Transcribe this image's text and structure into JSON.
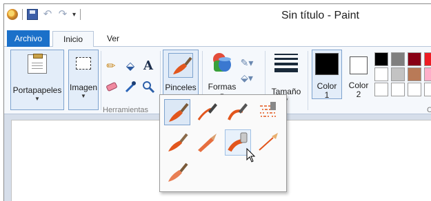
{
  "app": {
    "title": "Sin título - Paint"
  },
  "quick_access": {
    "icons": [
      "paint-app-icon",
      "save-icon",
      "undo-icon",
      "redo-icon",
      "customize-dropdown-icon"
    ]
  },
  "tabs": {
    "file": "Archivo",
    "home": "Inicio",
    "view": "Ver"
  },
  "ribbon": {
    "clipboard": {
      "label": "Portapapeles"
    },
    "image": {
      "label": "Imagen"
    },
    "tools": {
      "group_label": "Herramientas",
      "icons": [
        "pencil-icon",
        "fill-icon",
        "text-icon",
        "eraser-icon",
        "color-picker-icon",
        "magnifier-icon"
      ]
    },
    "brushes": {
      "label": "Pinceles"
    },
    "shapes": {
      "label": "Formas"
    },
    "size": {
      "label": "Tamaño"
    },
    "color1": {
      "label": "Color",
      "number": "1",
      "value": "#000000"
    },
    "color2": {
      "label": "Color",
      "number": "2",
      "value": "#ffffff"
    },
    "palette": [
      "#000000",
      "#7f7f7f",
      "#880015",
      "#ed1c24",
      "#ffffff",
      "#c3c3c3",
      "#b97a57",
      "#ffaec9",
      "#ffffff",
      "#ffffff",
      "#ffffff",
      "#ffffff"
    ],
    "colors_partial_label": "C"
  },
  "brush_menu": {
    "items": [
      "brush",
      "calligraphy-brush-1",
      "calligraphy-brush-2",
      "airbrush",
      "oil-brush",
      "crayon",
      "marker",
      "natural-pencil",
      "watercolor-brush"
    ],
    "selected_index": 0,
    "hover_index": 6
  },
  "colors": {
    "accent": "#1b70c9",
    "ribbon": "#f5f8fc",
    "brush_orange": "#e2561d"
  }
}
